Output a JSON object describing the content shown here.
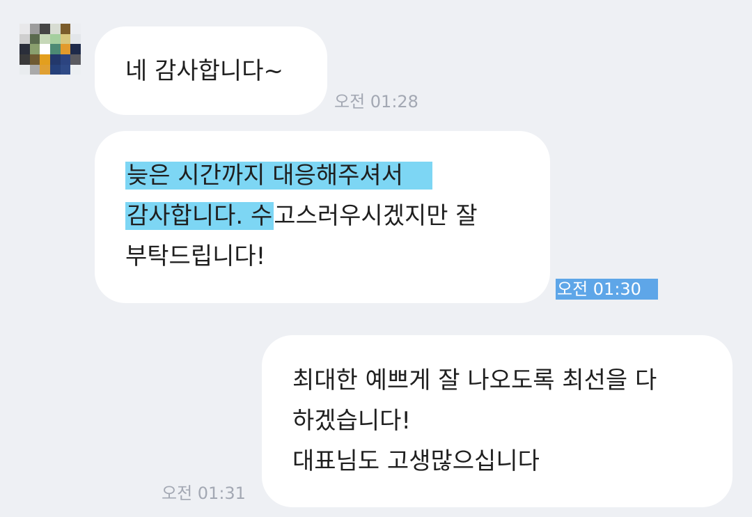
{
  "colors": {
    "background": "#eef0f4",
    "bubble": "#ffffff",
    "text": "#1f1f1f",
    "timestamp": "#a3a8b3",
    "selection_highlight": "#7dd6f4",
    "selected_timestamp": "#5ea6e8"
  },
  "avatar": {
    "icon": "pixelated-profile-avatar-icon",
    "pixels": [
      "#e8e8ea",
      "#9c9c9c",
      "#454545",
      "#d7dcd2",
      "#7b5c2b",
      "#eceef2",
      "#cfcfcf",
      "#5a6a4e",
      "#c6d8b8",
      "#a5cf9f",
      "#d8c67c",
      "#e3e6ea",
      "#2a2e3a",
      "#8a9f6e",
      "#ffffff",
      "#4d8a74",
      "#e29a2c",
      "#1e2a4a",
      "#3a3a3a",
      "#6f5a32",
      "#e39f1e",
      "#23386b",
      "#2c4480",
      "#5a5a60",
      "#e9ecef",
      "#a9a9a9",
      "#e0a032",
      "#25407a",
      "#2f4a86",
      "#eceff2",
      "#eef0f4",
      "#eef0f4",
      "#eef0f4",
      "#eef0f4",
      "#eef0f4",
      "#eef0f4"
    ]
  },
  "messages": [
    {
      "id": "msg1",
      "lines": [
        {
          "segments": [
            {
              "text": "네 감사합니다~",
              "highlight": false
            }
          ]
        }
      ],
      "time": "오전 01:28"
    },
    {
      "id": "msg2",
      "lines": [
        {
          "segments": [
            {
              "text": "늦은 시간까지 대응해주셔서",
              "highlight": true
            }
          ]
        },
        {
          "segments": [
            {
              "text": "감사합니다. 수",
              "highlight": true
            },
            {
              "text": "고스러우시겠지만 잘",
              "highlight": false
            }
          ]
        },
        {
          "segments": [
            {
              "text": "부탁드립니다!",
              "highlight": false
            }
          ]
        }
      ],
      "time": "오전 01:30"
    },
    {
      "id": "msg3",
      "lines": [
        {
          "segments": [
            {
              "text": "최대한 예쁘게 잘 나오도록 최선을 다",
              "highlight": false
            }
          ]
        },
        {
          "segments": [
            {
              "text": "하겠습니다!",
              "highlight": false
            }
          ]
        },
        {
          "segments": [
            {
              "text": "대표님도 고생많으십니다",
              "highlight": false
            }
          ]
        }
      ],
      "time": "오전 01:31"
    }
  ]
}
